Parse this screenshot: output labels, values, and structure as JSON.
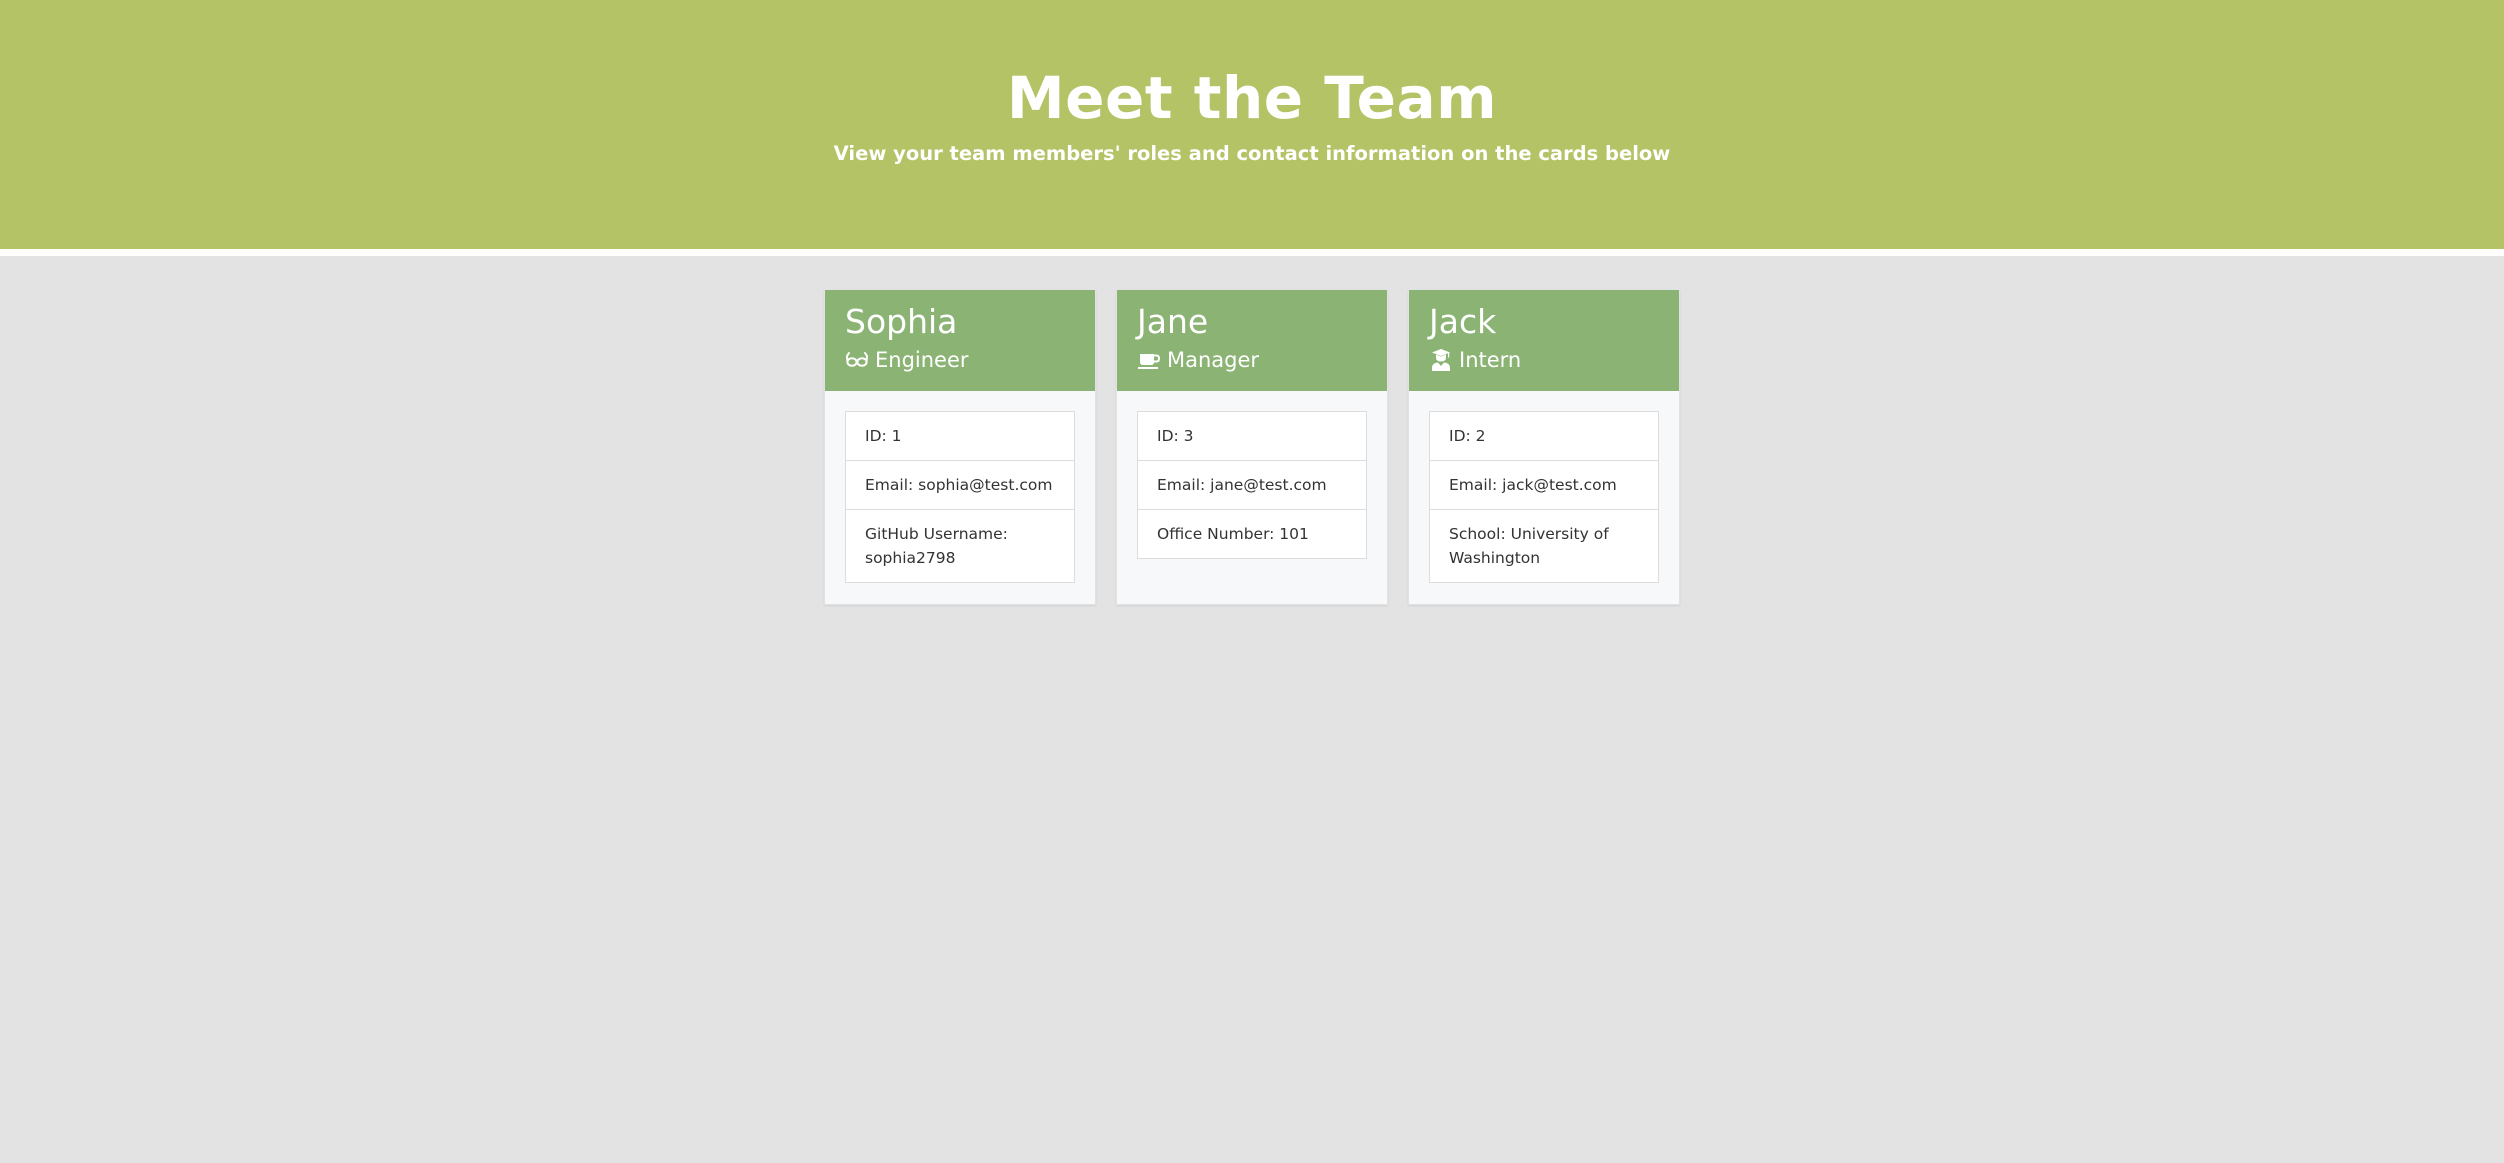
{
  "header": {
    "title": "Meet the Team",
    "subtitle": "View your team members' roles and contact information on the cards below"
  },
  "colors": {
    "header_bg": "#b5c367",
    "card_header_bg": "#8bb374",
    "page_bg": "#e3e3e3"
  },
  "cards": [
    {
      "name": "Sophia",
      "role": "Engineer",
      "role_icon": "glasses-icon",
      "id_text": "ID: 1",
      "email_text": "Email: sophia@test.com",
      "extra_text": "GitHub Username: sophia2798"
    },
    {
      "name": "Jane",
      "role": "Manager",
      "role_icon": "coffee-mug-icon",
      "id_text": "ID: 3",
      "email_text": "Email: jane@test.com",
      "extra_text": "Office Number: 101"
    },
    {
      "name": "Jack",
      "role": "Intern",
      "role_icon": "graduate-icon",
      "id_text": "ID: 2",
      "email_text": "Email: jack@test.com",
      "extra_text": "School: University of Washington"
    }
  ]
}
